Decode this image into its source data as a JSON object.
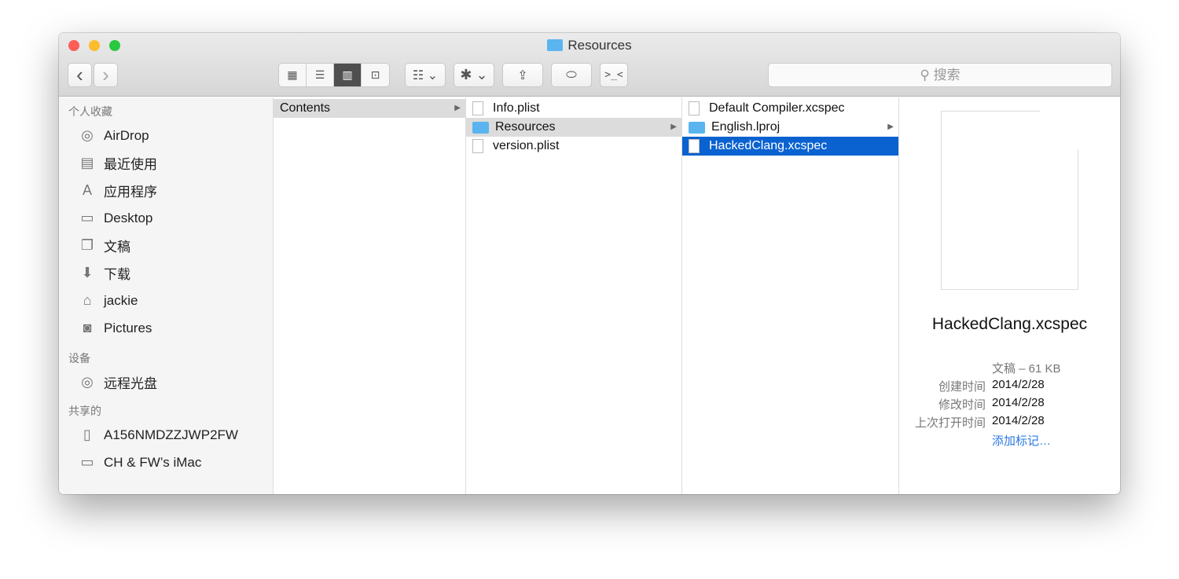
{
  "window": {
    "title": "Resources"
  },
  "toolbar": {
    "search_placeholder": "搜索",
    "back": "‹",
    "forward": "›"
  },
  "sidebar": {
    "favorites_header": "个人收藏",
    "favorites": [
      {
        "label": "AirDrop",
        "icon": "airdrop-icon",
        "glyph": "◎"
      },
      {
        "label": "最近使用",
        "icon": "recents-icon",
        "glyph": "▤"
      },
      {
        "label": "应用程序",
        "icon": "applications-icon",
        "glyph": "A"
      },
      {
        "label": "Desktop",
        "icon": "desktop-icon",
        "glyph": "▭"
      },
      {
        "label": "文稿",
        "icon": "documents-icon",
        "glyph": "❐"
      },
      {
        "label": "下载",
        "icon": "downloads-icon",
        "glyph": "⬇"
      },
      {
        "label": "jackie",
        "icon": "home-icon",
        "glyph": "⌂"
      },
      {
        "label": "Pictures",
        "icon": "camera-icon",
        "glyph": "◙"
      }
    ],
    "devices_header": "设备",
    "devices": [
      {
        "label": "远程光盘",
        "icon": "disc-icon",
        "glyph": "◎"
      }
    ],
    "shared_header": "共享的",
    "shared": [
      {
        "label": "A156NMDZZJWP2FW",
        "icon": "server-icon",
        "glyph": "▯"
      },
      {
        "label": "CH & FW’s iMac",
        "icon": "imac-icon",
        "glyph": "▭"
      }
    ]
  },
  "columns": [
    [
      {
        "name": "Contents",
        "type": "folder-plain",
        "state": "selected",
        "arrow": true
      }
    ],
    [
      {
        "name": "Info.plist",
        "type": "file"
      },
      {
        "name": "Resources",
        "type": "folder",
        "state": "selected",
        "arrow": true
      },
      {
        "name": "version.plist",
        "type": "file"
      }
    ],
    [
      {
        "name": "Default Compiler.xcspec",
        "type": "file"
      },
      {
        "name": "English.lproj",
        "type": "folder",
        "arrow": true
      },
      {
        "name": "HackedClang.xcspec",
        "type": "file",
        "state": "active"
      }
    ]
  ],
  "preview": {
    "name": "HackedClang.xcspec",
    "kind": "文稿 – 61 KB",
    "created_label": "创建时间",
    "created": "2014/2/28",
    "modified_label": "修改时间",
    "modified": "2014/2/28",
    "opened_label": "上次打开时间",
    "opened": "2014/2/28",
    "add_tags": "添加标记…",
    "accent": "#0a62d0"
  }
}
